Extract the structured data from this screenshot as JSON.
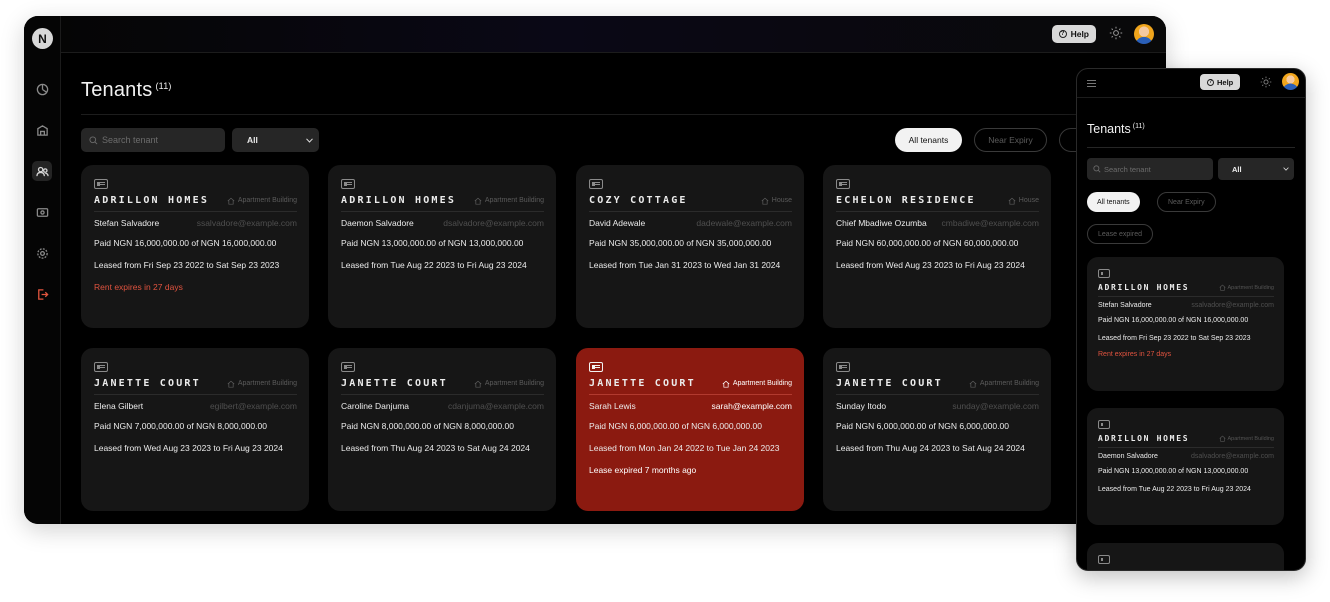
{
  "desktop": {
    "logo_letter": "N",
    "help_label": "Help",
    "title": "Tenants",
    "count": "(11)",
    "search_placeholder": "Search tenant",
    "filter_value": "All",
    "filters": [
      "All tenants",
      "Near Expiry",
      "L"
    ],
    "cards": [
      {
        "property": "ADRILLON HOMES",
        "type": "Apartment Building",
        "tenant": "Stefan Salvadore",
        "email": "ssalvadore@example.com",
        "payment": "Paid NGN 16,000,000.00 of NGN 16,000,000.00",
        "lease": "Leased from Fri Sep 23 2022 to Sat Sep 23 2023",
        "status": "Rent expires in 27 days"
      },
      {
        "property": "ADRILLON HOMES",
        "type": "Apartment Building",
        "tenant": "Daemon Salvadore",
        "email": "dsalvadore@example.com",
        "payment": "Paid NGN 13,000,000.00 of NGN 13,000,000.00",
        "lease": "Leased from Tue Aug 22 2023 to Fri Aug 23 2024",
        "status": ""
      },
      {
        "property": "COZY COTTAGE",
        "type": "House",
        "tenant": "David Adewale",
        "email": "dadewale@example.com",
        "payment": "Paid NGN 35,000,000.00 of NGN 35,000,000.00",
        "lease": "Leased from Tue Jan 31 2023 to Wed Jan 31 2024",
        "status": ""
      },
      {
        "property": "ECHELON RESIDENCE",
        "type": "House",
        "tenant": "Chief Mbadiwe Ozumba",
        "email": "cmbadiwe@example.com",
        "payment": "Paid NGN 60,000,000.00 of NGN 60,000,000.00",
        "lease": "Leased from Wed Aug 23 2023 to Fri Aug 23 2024",
        "status": ""
      },
      {
        "property": "JANETTE COURT",
        "type": "Apartment Building",
        "tenant": "Elena Gilbert",
        "email": "egilbert@example.com",
        "payment": "Paid NGN 7,000,000.00 of NGN 8,000,000.00",
        "lease": "Leased from Wed Aug 23 2023 to Fri Aug 23 2024",
        "status": ""
      },
      {
        "property": "JANETTE COURT",
        "type": "Apartment Building",
        "tenant": "Caroline Danjuma",
        "email": "cdanjuma@example.com",
        "payment": "Paid NGN 8,000,000.00 of NGN 8,000,000.00",
        "lease": "Leased from Thu Aug 24 2023 to Sat Aug 24 2024",
        "status": ""
      },
      {
        "property": "JANETTE COURT",
        "type": "Apartment Building",
        "tenant": "Sarah Lewis",
        "email": "sarah@example.com",
        "payment": "Paid NGN 6,000,000.00 of NGN 6,000,000.00",
        "lease": "Leased from Mon Jan 24 2022 to Tue Jan 24 2023",
        "status": "Lease expired 7 months ago"
      },
      {
        "property": "JANETTE COURT",
        "type": "Apartment Building",
        "tenant": "Sunday Itodo",
        "email": "sunday@example.com",
        "payment": "Paid NGN 6,000,000.00 of NGN 6,000,000.00",
        "lease": "Leased from Thu Aug 24 2023 to Sat Aug 24 2024",
        "status": ""
      }
    ]
  },
  "mobile": {
    "help_label": "Help",
    "title": "Tenants",
    "count": "(11)",
    "search_placeholder": "Search tenant",
    "filter_value": "All",
    "filters": [
      "All tenants",
      "Near Expiry",
      "Lease expired"
    ],
    "cards": [
      {
        "property": "ADRILLON HOMES",
        "type": "Apartment Building",
        "tenant": "Stefan Salvadore",
        "email": "ssalvadore@example.com",
        "payment": "Paid NGN 16,000,000.00 of NGN 16,000,000.00",
        "lease": "Leased from Fri Sep 23 2022 to Sat Sep 23 2023",
        "status": "Rent expires in 27 days"
      },
      {
        "property": "ADRILLON HOMES",
        "type": "Apartment Building",
        "tenant": "Daemon Salvadore",
        "email": "dsalvadore@example.com",
        "payment": "Paid NGN 13,000,000.00 of NGN 13,000,000.00",
        "lease": "Leased from Tue Aug 22 2023 to Fri Aug 23 2024",
        "status": ""
      }
    ]
  },
  "colors": {
    "accent_expired": "#8b1a10",
    "warning": "#e0533f",
    "card_bg": "#161616"
  },
  "icons": [
    "logo-icon",
    "dashboard-icon",
    "properties-icon",
    "tenants-icon",
    "payments-icon",
    "settings-icon",
    "logout-icon",
    "help-icon",
    "theme-toggle-icon",
    "search-icon",
    "id-card-icon",
    "house-icon",
    "menu-icon"
  ]
}
